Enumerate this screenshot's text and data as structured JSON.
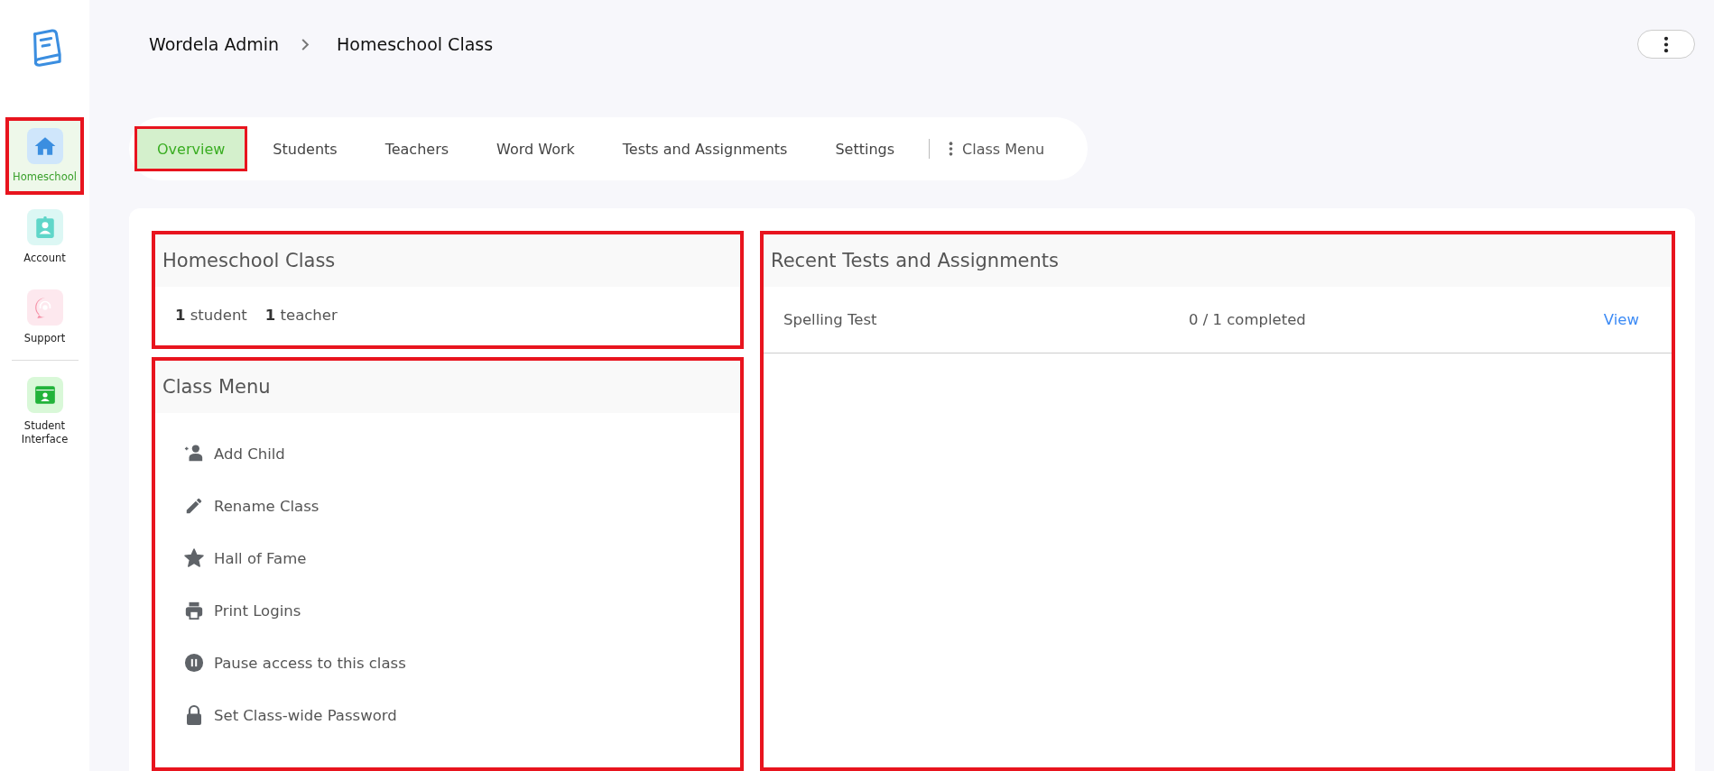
{
  "sidebar": {
    "items": [
      {
        "kind": "home",
        "label": "Homeschool",
        "selected": true,
        "highlighted": true
      },
      {
        "kind": "account",
        "label": "Account",
        "selected": false,
        "highlighted": false
      },
      {
        "kind": "support",
        "label": "Support",
        "selected": false,
        "highlighted": false
      },
      {
        "kind": "student",
        "label": "Student Interface",
        "selected": false,
        "highlighted": false
      }
    ]
  },
  "breadcrumb": [
    "Wordela Admin",
    "Homeschool Class"
  ],
  "tabs": [
    {
      "label": "Overview",
      "selected": true,
      "highlighted": true
    },
    {
      "label": "Students",
      "selected": false,
      "highlighted": false
    },
    {
      "label": "Teachers",
      "selected": false,
      "highlighted": false
    },
    {
      "label": "Word Work",
      "selected": false,
      "highlighted": false
    },
    {
      "label": "Tests and Assignments",
      "selected": false,
      "highlighted": false
    },
    {
      "label": "Settings",
      "selected": false,
      "highlighted": false
    }
  ],
  "class_menu_tab": {
    "label": "Class Menu"
  },
  "class_panel": {
    "title": "Homeschool Class",
    "highlighted": true,
    "counts": [
      {
        "number": "1",
        "label": "student"
      },
      {
        "number": "1",
        "label": "teacher"
      }
    ]
  },
  "menu_panel": {
    "title": "Class Menu",
    "highlighted": true,
    "items": [
      {
        "kind": "add-person",
        "label": "Add Child"
      },
      {
        "kind": "pencil",
        "label": "Rename Class"
      },
      {
        "kind": "star",
        "label": "Hall of Fame"
      },
      {
        "kind": "printer",
        "label": "Print Logins"
      },
      {
        "kind": "pause",
        "label": "Pause access to this class"
      },
      {
        "kind": "lock",
        "label": "Set Class-wide Password"
      }
    ]
  },
  "recent_panel": {
    "title": "Recent Tests and Assignments",
    "highlighted": true,
    "rows": [
      {
        "name": "Spelling Test",
        "progress": "0 / 1 completed",
        "action": "View"
      }
    ]
  }
}
